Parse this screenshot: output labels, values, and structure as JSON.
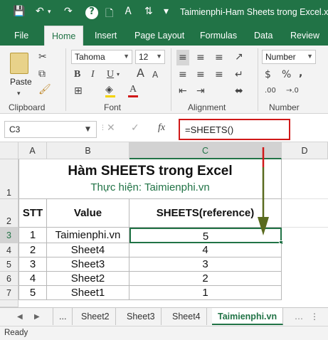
{
  "window": {
    "title": "Taimienphi-Ham Sheets trong Excel.xls"
  },
  "ribbon_tabs": [
    "File",
    "Home",
    "Insert",
    "Page Layout",
    "Formulas",
    "Data",
    "Review"
  ],
  "active_tab": "Home",
  "clipboard": {
    "paste_label": "Paste",
    "group": "Clipboard"
  },
  "font": {
    "name": "Tahoma",
    "size": "12",
    "group": "Font",
    "bold": "B",
    "italic": "I",
    "underline": "U"
  },
  "alignment": {
    "group": "Alignment"
  },
  "number": {
    "format": "Number",
    "group": "Number",
    "currency": "$",
    "percent": "%",
    "comma": ",",
    "dec_inc": ".00",
    "dec_dec": "→.0"
  },
  "formula_bar": {
    "name_box": "C3",
    "fx": "fx",
    "formula": "=SHEETS()"
  },
  "columns": [
    "A",
    "B",
    "C",
    "D"
  ],
  "rows": [
    "1",
    "2",
    "3",
    "4",
    "5",
    "6",
    "7"
  ],
  "sheet": {
    "title": "Hàm SHEETS trong Excel",
    "subtitle": "Thực hiện: Taimienphi.vn",
    "headers": [
      "STT",
      "Value",
      "SHEETS(reference)"
    ],
    "data": [
      [
        "1",
        "Taimienphi.vn",
        "5"
      ],
      [
        "2",
        "Sheet4",
        "4"
      ],
      [
        "3",
        "Sheet3",
        "3"
      ],
      [
        "4",
        "Sheet2",
        "2"
      ],
      [
        "5",
        "Sheet1",
        "1"
      ]
    ]
  },
  "sheet_tabs": {
    "ellipsis": "...",
    "tabs": [
      "Sheet2",
      "Sheet3",
      "Sheet4",
      "Taimienphi.vn"
    ],
    "active": "Taimienphi.vn"
  },
  "status": "Ready",
  "colors": {
    "accent": "#217346",
    "highlight": "#d01919",
    "arrow": "#5a6b1f"
  }
}
